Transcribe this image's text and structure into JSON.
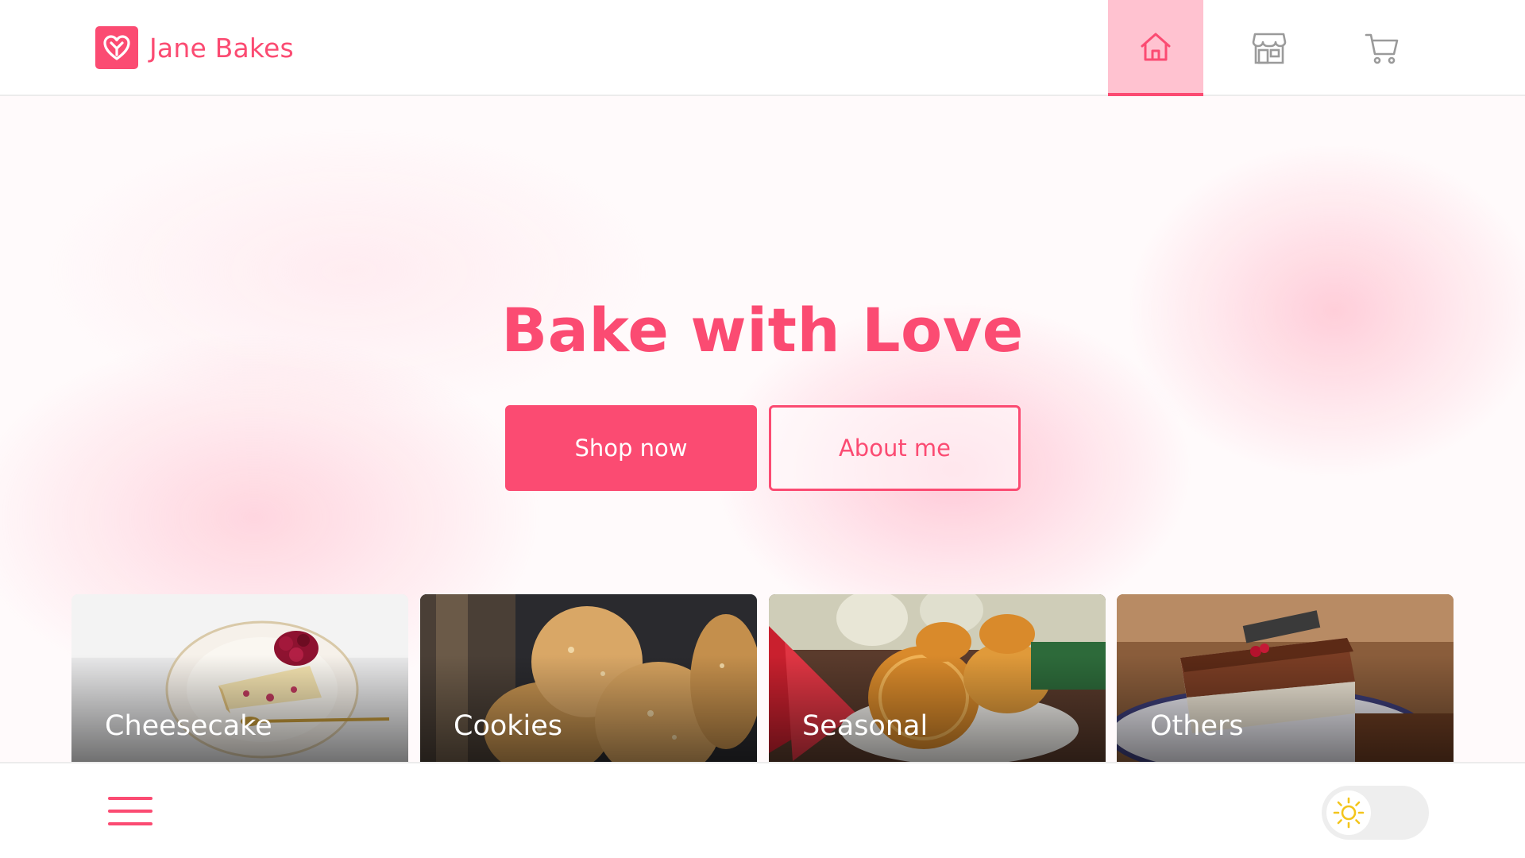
{
  "brand": {
    "name": "Jane Bakes",
    "icon": "heart-icon"
  },
  "nav": {
    "items": [
      {
        "id": "home",
        "icon": "home-icon",
        "active": true
      },
      {
        "id": "shop",
        "icon": "store-icon",
        "active": false
      },
      {
        "id": "cart",
        "icon": "cart-icon",
        "active": false
      }
    ]
  },
  "hero": {
    "title": "Bake with Love",
    "primary_button": "Shop now",
    "secondary_button": "About me"
  },
  "categories": [
    {
      "label": "Cheesecake"
    },
    {
      "label": "Cookies"
    },
    {
      "label": "Seasonal"
    },
    {
      "label": "Others"
    }
  ],
  "bottom_bar": {
    "menu_icon": "hamburger-menu-icon",
    "theme_icon": "sun-icon"
  },
  "colors": {
    "accent": "#fb4b72",
    "accent_light": "#ffc2d0"
  }
}
